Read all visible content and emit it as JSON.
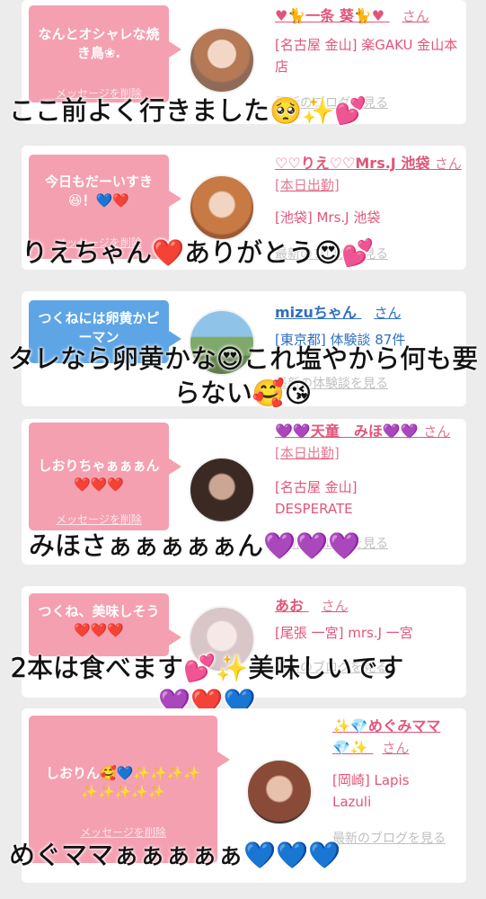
{
  "delete_label": "メッセージを削除",
  "blog_label": "最新のブログを見る",
  "cards": [
    {
      "bubble": "なんとオシャレな焼き鳥❀.",
      "name": "♥🐈一条 葵🐈♥",
      "san": "さん",
      "shop": "[名古屋 金山] 楽GAKU 金山本店",
      "blog": "最新のブログを見る",
      "overlay": "ここ前よく行きました🥺✨💕"
    },
    {
      "bubble": "今日もだーいすき😆！💙❤️",
      "name": "♡♡りえ♡♡Mrs.J 池袋",
      "san": "さん[本日出勤]",
      "shop": "[池袋] Mrs.J 池袋",
      "blog": "最新のブログを見る",
      "overlay": "りえちゃん❤️ありがとう😍💕"
    },
    {
      "bubble": "つくねには卵黄かピーマン",
      "name": "mizuちゃん",
      "san": "さん",
      "shop": "[東京都] 体験談 87件",
      "blog": "最新の体験談を見る",
      "overlay": "タレなら卵黄かな😍これ塩やから何も要らない🥰😘"
    },
    {
      "bubble": "しおりちゃぁぁぁん❤️❤️❤️",
      "name": "💜💜天童　みほ💜💜",
      "san": "さん[本日出勤]",
      "shop": "[名古屋 金山] DESPERATE",
      "blog": "最新のブログを見る",
      "overlay": "みほさぁぁぁぁぁん💜💜💜"
    },
    {
      "bubble": "つくね、美味しそう❤️❤️❤️",
      "name": "あお",
      "san": "さん",
      "shop": "[尾張 一宮] mrs.J 一宮",
      "blog": "最新のブログを見る",
      "overlay": "2本は食べます💕✨美味しいです💜❤️💙"
    },
    {
      "bubble": "しおりん🥰💙✨✨✨✨✨✨✨✨✨",
      "name": "✨💎めぐみママ💎✨",
      "san": "さん",
      "shop": "[岡崎] Lapis Lazuli",
      "blog": "最新のブログを見る",
      "overlay": "めぐママぁぁぁぁぁ💙💙💙"
    }
  ],
  "colors": {
    "bubble_pink": "#f4a0b1",
    "bubble_blue": "#5ea5e6",
    "name_pink": "#e2557a",
    "name_blue": "#2f6fbf",
    "page_bg": "#ececec"
  }
}
